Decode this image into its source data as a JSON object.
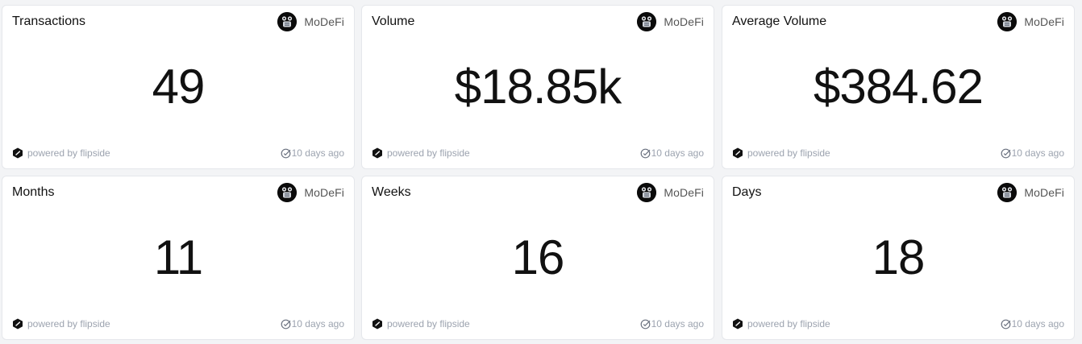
{
  "cards": [
    {
      "title": "Transactions",
      "author": "MoDeFi",
      "value": "49",
      "powered": "powered by flipside",
      "updated": "10 days ago"
    },
    {
      "title": "Volume",
      "author": "MoDeFi",
      "value": "$18.85k",
      "powered": "powered by flipside",
      "updated": "10 days ago"
    },
    {
      "title": "Average Volume",
      "author": "MoDeFi",
      "value": "$384.62",
      "powered": "powered by flipside",
      "updated": "10 days ago"
    },
    {
      "title": "Months",
      "author": "MoDeFi",
      "value": "11",
      "powered": "powered by flipside",
      "updated": "10 days ago"
    },
    {
      "title": "Weeks",
      "author": "MoDeFi",
      "value": "16",
      "powered": "powered by flipside",
      "updated": "10 days ago"
    },
    {
      "title": "Days",
      "author": "MoDeFi",
      "value": "18",
      "powered": "powered by flipside",
      "updated": "10 days ago"
    }
  ],
  "colors": {
    "background": "#f3f4f6",
    "card": "#ffffff",
    "border": "#e5e7eb",
    "text": "#111111",
    "muted": "#9ca3af"
  },
  "icons": {
    "avatar": "avatar-robot-icon",
    "powered": "flipside-logo-icon",
    "updated": "check-circle-icon"
  }
}
